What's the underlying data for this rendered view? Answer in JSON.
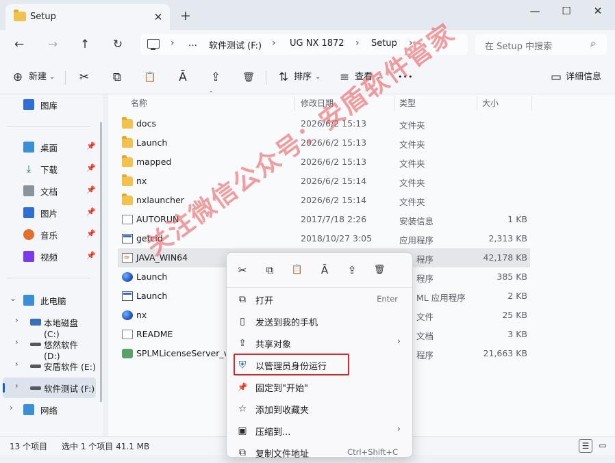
{
  "window": {
    "tab_title": "Setup",
    "tab_close": "✕",
    "new_tab": "+",
    "minimize": "—",
    "maximize": "☐",
    "close": "✕"
  },
  "nav": {
    "back": "←",
    "forward": "→",
    "up": "↑",
    "refresh": "↻"
  },
  "address": {
    "more": "…",
    "crumbs": [
      "软件测试 (F:)",
      "UG NX 1872",
      "Setup"
    ],
    "separator": "›"
  },
  "search": {
    "placeholder": "在 Setup 中搜索",
    "icon": "⌕"
  },
  "toolbar": {
    "new_label": "新建",
    "sort_label": "排序",
    "view_label": "查看",
    "more": "•••",
    "details_label": "详细信息",
    "icons": {
      "new": "⊕",
      "cut": "✂",
      "copy": "⧉",
      "paste": "📋",
      "rename": "Ā",
      "share": "⇪",
      "delete": "🗑",
      "sort": "⇅",
      "view": "≡",
      "details": "▭"
    }
  },
  "sidebar": {
    "items": [
      {
        "label": "图库",
        "icon": "gallery-icon",
        "color": "#2f6fd1"
      },
      {
        "label": "桌面",
        "icon": "desktop-icon",
        "color": "#3a8fd8",
        "pinned": true
      },
      {
        "label": "下载",
        "icon": "download-icon",
        "color": "#1e8a4c",
        "pinned": true
      },
      {
        "label": "文档",
        "icon": "documents-icon",
        "color": "#6b7280",
        "pinned": true
      },
      {
        "label": "图片",
        "icon": "pictures-icon",
        "color": "#2f6fd1",
        "pinned": true
      },
      {
        "label": "音乐",
        "icon": "music-icon",
        "color": "#e0702b",
        "pinned": true
      },
      {
        "label": "视频",
        "icon": "videos-icon",
        "color": "#7c3aed",
        "pinned": true
      },
      {
        "label": "此电脑",
        "icon": "this-pc-icon",
        "color": "#3a8fd8"
      },
      {
        "label": "本地磁盘 (C:)",
        "icon": "drive-c-icon",
        "color": "#3a6fb8"
      },
      {
        "label": "悠然软件 (D:)",
        "icon": "drive-icon",
        "color": "#6b7280"
      },
      {
        "label": "安盾软件 (E:)",
        "icon": "drive-icon",
        "color": "#6b7280"
      },
      {
        "label": "软件测试 (F:)",
        "icon": "drive-icon",
        "color": "#6b7280"
      },
      {
        "label": "网络",
        "icon": "network-icon",
        "color": "#3a8fd8"
      }
    ],
    "pin_glyph": "📌",
    "chevron_down": "⌄",
    "chevron_right": "›"
  },
  "columns": {
    "name": "名称",
    "date": "修改日期",
    "type": "类型",
    "size": "大小"
  },
  "files": [
    {
      "name": "docs",
      "date": "2026/6/2 15:13",
      "type": "文件夹",
      "size": "",
      "icon": "folder-icon"
    },
    {
      "name": "Launch",
      "date": "2026/6/2 15:13",
      "type": "文件夹",
      "size": "",
      "icon": "folder-icon"
    },
    {
      "name": "mapped",
      "date": "2026/6/2 15:13",
      "type": "文件夹",
      "size": "",
      "icon": "folder-icon"
    },
    {
      "name": "nx",
      "date": "2026/6/2 15:14",
      "type": "文件夹",
      "size": "",
      "icon": "folder-icon"
    },
    {
      "name": "nxlauncher",
      "date": "2026/6/2 15:14",
      "type": "文件夹",
      "size": "",
      "icon": "folder-icon"
    },
    {
      "name": "AUTORUN",
      "date": "2017/7/18 2:26",
      "type": "安装信息",
      "size": "1 KB",
      "icon": "setup-info-icon"
    },
    {
      "name": "getcid",
      "date": "2018/10/27 3:05",
      "type": "应用程序",
      "size": "2,313 KB",
      "icon": "app-icon"
    },
    {
      "name": "JAVA_WIN64",
      "date": "",
      "type": "程序",
      "size": "42,178 KB",
      "icon": "java-icon"
    },
    {
      "name": "Launch",
      "date": "",
      "type": "程序",
      "size": "385 KB",
      "icon": "launch-globe-icon"
    },
    {
      "name": "Launch",
      "date": "",
      "type": "ML 应用程序",
      "size": "2 KB",
      "icon": "hta-app-icon"
    },
    {
      "name": "nx",
      "date": "",
      "type": "文件",
      "size": "25 KB",
      "icon": "nx-globe-icon"
    },
    {
      "name": "README",
      "date": "",
      "type": "文档",
      "size": "3 KB",
      "icon": "text-doc-icon"
    },
    {
      "name": "SPLMLicenseServer_v9...",
      "date": "",
      "type": "程序",
      "size": "21,663 KB",
      "icon": "installer-icon"
    }
  ],
  "status": {
    "count": "13 个项目",
    "selection": "选中 1 个项目  41.1 MB"
  },
  "context_menu": {
    "top_icons": [
      "cut-icon",
      "copy-icon",
      "paste-icon",
      "rename-icon",
      "share-icon",
      "delete-icon"
    ],
    "top_glyphs": [
      "✂",
      "⧉",
      "📋",
      "Ā",
      "⇪",
      "🗑"
    ],
    "items": [
      {
        "label": "打开",
        "shortcut": "Enter",
        "icon": "open-icon",
        "glyph": "⧉"
      },
      {
        "label": "发送到我的手机",
        "shortcut": "",
        "icon": "phone-icon",
        "glyph": "▯"
      },
      {
        "label": "共享对象",
        "shortcut": "",
        "icon": "share-icon",
        "glyph": "⇪",
        "submenu": true
      },
      {
        "label": "以管理员身份运行",
        "shortcut": "",
        "icon": "shield-icon",
        "glyph": "⛨"
      },
      {
        "label": "固定到\"开始\"",
        "shortcut": "",
        "icon": "pin-icon",
        "glyph": "📌"
      },
      {
        "label": "添加到收藏夹",
        "shortcut": "",
        "icon": "star-icon",
        "glyph": "☆"
      },
      {
        "label": "压缩到...",
        "shortcut": "",
        "icon": "zip-icon",
        "glyph": "▣",
        "submenu": true
      },
      {
        "label": "复制文件地址",
        "shortcut": "Ctrl+Shift+C",
        "icon": "copy-path-icon",
        "glyph": "⧉"
      }
    ],
    "submenu_arrow": "›"
  },
  "watermark": "关注微信公众号：安盾软件管家",
  "colors": {
    "accent": "#0a64c8",
    "highlight_box": "#e02424",
    "watermark": "#e85050"
  }
}
